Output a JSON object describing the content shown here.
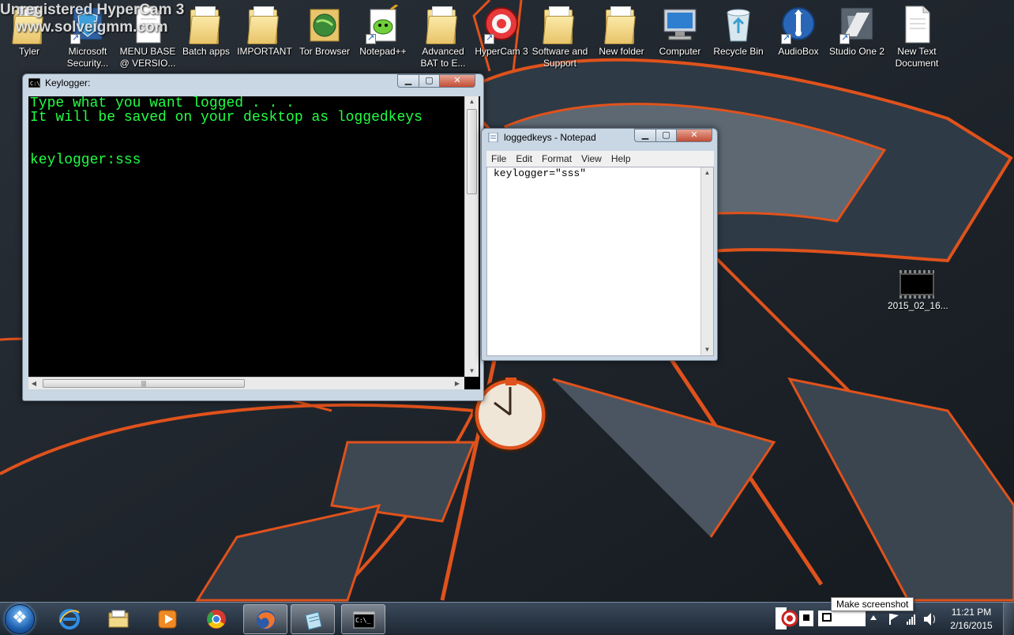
{
  "watermark": {
    "line1": "Unregistered HyperCam 3",
    "line2": "www.solveigmm.com"
  },
  "desktop_icons": [
    {
      "label": "Tyler",
      "icon": "folder-icon",
      "shortcut": false
    },
    {
      "label": "Microsoft Security...",
      "icon": "security-shield-icon",
      "shortcut": true
    },
    {
      "label": "MENU BASE @ VERSIO...",
      "icon": "text-document-icon",
      "shortcut": false
    },
    {
      "label": "Batch apps",
      "icon": "folder-icon",
      "shortcut": false
    },
    {
      "label": "IMPORTANT",
      "icon": "folder-icon",
      "shortcut": false
    },
    {
      "label": "Tor Browser",
      "icon": "tor-browser-icon",
      "shortcut": false
    },
    {
      "label": "Notepad++",
      "icon": "notepad-plus-plus-icon",
      "shortcut": true
    },
    {
      "label": "Advanced BAT to E...",
      "icon": "folder-icon",
      "shortcut": false
    },
    {
      "label": "HyperCam 3",
      "icon": "hypercam-icon",
      "shortcut": true
    },
    {
      "label": "Software and Support",
      "icon": "folder-icon",
      "shortcut": false
    },
    {
      "label": "New folder",
      "icon": "folder-icon",
      "shortcut": false
    },
    {
      "label": "Computer",
      "icon": "computer-icon",
      "shortcut": false
    },
    {
      "label": "Recycle Bin",
      "icon": "recycle-bin-icon",
      "shortcut": false
    },
    {
      "label": "AudioBox",
      "icon": "audiobox-usb-icon",
      "shortcut": true
    },
    {
      "label": "Studio One 2",
      "icon": "studio-one-icon",
      "shortcut": true
    },
    {
      "label": "New Text Document",
      "icon": "text-document-icon",
      "shortcut": false
    }
  ],
  "console": {
    "title": "Keylogger:",
    "lines": [
      "Type what you want logged . . .",
      "It will be saved on your desktop as loggedkeys",
      "",
      "",
      "keylogger:sss"
    ]
  },
  "notepad": {
    "title": "loggedkeys - Notepad",
    "menu": [
      "File",
      "Edit",
      "Format",
      "View",
      "Help"
    ],
    "content": "keylogger=\"sss\""
  },
  "video_file": {
    "label": "2015_02_16..."
  },
  "taskbar": {
    "pinned": [
      {
        "name": "internet-explorer-button",
        "icon": "internet-explorer-icon"
      },
      {
        "name": "windows-explorer-button",
        "icon": "folder-library-icon"
      },
      {
        "name": "media-player-button",
        "icon": "media-player-icon"
      },
      {
        "name": "chrome-button",
        "icon": "chrome-icon"
      },
      {
        "name": "firefox-button",
        "icon": "firefox-icon",
        "active": true
      },
      {
        "name": "notepad-button",
        "icon": "notepad-icon",
        "active": true
      },
      {
        "name": "cmd-button",
        "icon": "command-prompt-icon",
        "active": true
      }
    ],
    "tooltip": "Make screenshot",
    "clock": {
      "time": "11:21 PM",
      "date": "2/16/2015"
    }
  },
  "colors": {
    "console_text": "#22ff44",
    "console_bg": "#000000",
    "wallpaper_accent": "#e0521c"
  }
}
